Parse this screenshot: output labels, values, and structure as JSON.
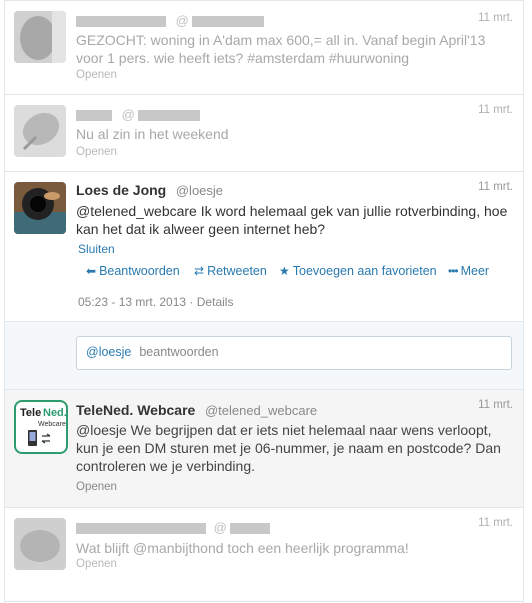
{
  "tweets": [
    {
      "time": "11 mrt.",
      "text": "GEZOCHT: woning in A'dam max 600,= all in. Vanaf begin April'13 voor 1 pers. wie heeft iets? #amsterdam #huurwoning",
      "open_label": "Openen",
      "at": "@"
    },
    {
      "time": "11 mrt.",
      "text": "Nu al zin in het weekend",
      "open_label": "Openen",
      "at": "@"
    }
  ],
  "focused": {
    "name": "Loes de Jong",
    "handle": "@loesje",
    "time": "11 mrt.",
    "text": "@telened_webcare Ik word helemaal gek van jullie rotverbinding, hoe kan het dat ik alweer geen internet heb?",
    "close_label": "Sluiten",
    "actions": {
      "reply": "Beantwoorden",
      "retweet": "Retweeten",
      "favorite": "Toevoegen aan favorieten",
      "more": "Meer"
    },
    "timestamp": "05:23 - 13 mrt. 2013",
    "details": "Details",
    "reply_box": {
      "mention": "@loesje",
      "placeholder": "beantwoorden"
    }
  },
  "webcare": {
    "name": "TeleNed. Webcare",
    "handle": "@telened_webcare",
    "time": "11 mrt.",
    "logo_top": "TeleNed.",
    "logo_sub": "Webcare",
    "text": "@loesje We begrijpen dat er iets niet helemaal naar wens verloopt, kun je een DM sturen met je 06-nummer, je naam en postcode? Dan controleren we je verbinding.",
    "open_label": "Openen"
  },
  "last_tweet": {
    "time": "11 mrt.",
    "at": "@",
    "text": "Wat blijft @manbijthond toch een heerlijk programma!",
    "open_label": "Openen"
  },
  "colors": {
    "link": "#2a7ab0",
    "redacted": "#c8c8c8",
    "logo_green": "#2e9b6e"
  }
}
